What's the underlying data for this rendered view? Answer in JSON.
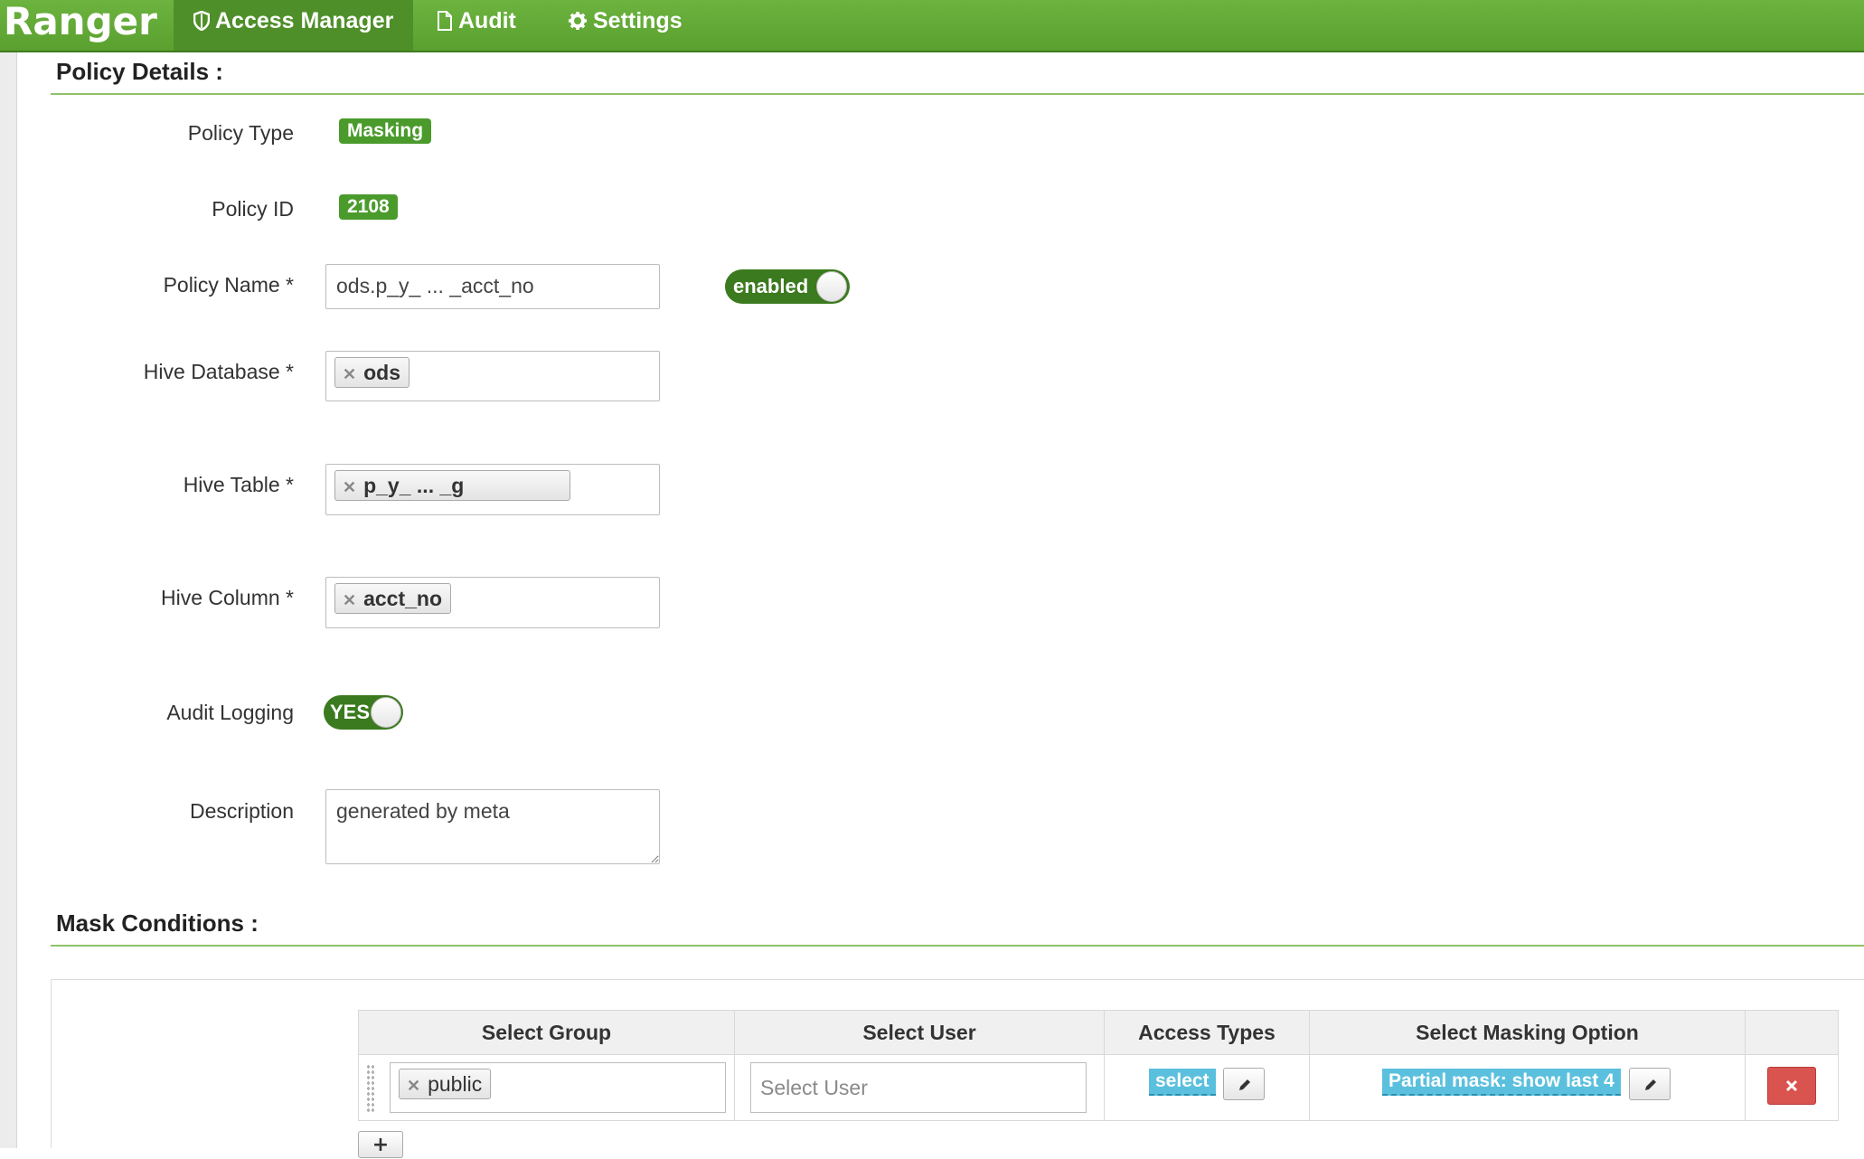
{
  "nav": {
    "brand": "Ranger",
    "items": [
      {
        "label": "Access Manager",
        "icon": "shield-icon"
      },
      {
        "label": "Audit",
        "icon": "file-icon"
      },
      {
        "label": "Settings",
        "icon": "gear-icon"
      }
    ]
  },
  "policy_details": {
    "title": "Policy Details :",
    "policy_type_label": "Policy Type",
    "policy_type_value": "Masking",
    "policy_id_label": "Policy ID",
    "policy_id_value": "2108",
    "policy_name_label": "Policy Name *",
    "policy_name_value": "ods.p_y_ ... _acct_no",
    "enabled_toggle": "enabled",
    "hive_database_label": "Hive Database *",
    "hive_database_tag": "ods",
    "hive_table_label": "Hive Table *",
    "hive_table_tag": "p_y_ ... _g",
    "hive_column_label": "Hive Column *",
    "hive_column_tag": "acct_no",
    "audit_logging_label": "Audit Logging",
    "audit_logging_toggle": "YES",
    "description_label": "Description",
    "description_value": "generated by meta"
  },
  "mask_conditions": {
    "title": "Mask Conditions :",
    "headers": [
      "Select Group",
      "Select User",
      "Access Types",
      "Select Masking Option"
    ],
    "rows": [
      {
        "group_tag": "public",
        "user_placeholder": "Select User",
        "access_type": "select",
        "masking_option": "Partial mask: show last 4"
      }
    ],
    "add_label": "+"
  },
  "colors": {
    "navbar": "#6cb33f",
    "badge": "#4a9b2c",
    "toggle": "#3b7a1e",
    "chip": "#5bc0de",
    "delete": "#d9534f"
  }
}
